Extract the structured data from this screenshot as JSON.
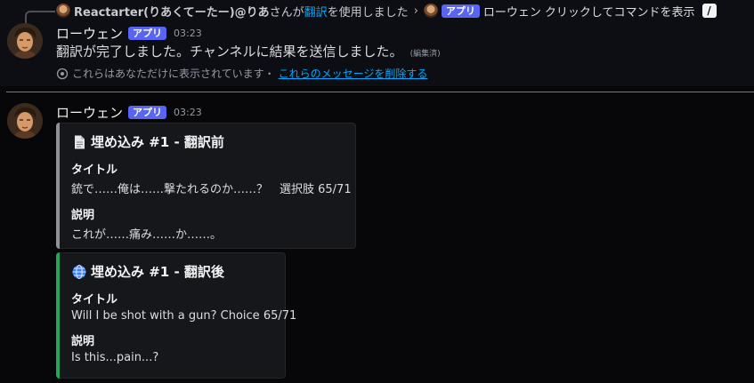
{
  "reply": {
    "user": "Reactarter(りあくてーたー)@りあ",
    "text_before": "さんが",
    "command": "翻訳",
    "text_after": "を使用しました",
    "chevron": "›",
    "bot_badge": "アプリ",
    "bot_name": "ローウェン",
    "action_text": "クリックしてコマンドを表示",
    "slash_icon": "slash-command-icon"
  },
  "ephemeral_message": {
    "username": "ローウェン",
    "badge": "アプリ",
    "time": "03:23",
    "content": "翻訳が完了しました。チャンネルに結果を送信しました。",
    "edited": "(編集済)",
    "notice": "これらはあなただけに表示されています・",
    "dismiss": "これらのメッセージを削除する"
  },
  "message": {
    "username": "ローウェン",
    "badge": "アプリ",
    "time": "03:23",
    "embeds": [
      {
        "icon": "document-icon",
        "title": "埋め込み #1 - 翻訳前",
        "accent": "#8e9297",
        "fields": [
          {
            "name": "タイトル",
            "value": "銃で……俺は……撃たれるのか……？　選択肢 65/71"
          },
          {
            "name": "説明",
            "value": "これが……痛み……か……。"
          }
        ]
      },
      {
        "icon": "globe-icon",
        "title": "埋め込み #1 - 翻訳後",
        "accent": "#23a55a",
        "fields": [
          {
            "name": "タイトル",
            "value": "Will I be shot with a gun? Choice 65/71"
          },
          {
            "name": "説明",
            "value": "Is this...pain...?"
          }
        ]
      }
    ]
  },
  "colors": {
    "background": "#070709",
    "link": "#00a8fc",
    "badge": "#5865f2",
    "new_divider": "#d0573e"
  }
}
